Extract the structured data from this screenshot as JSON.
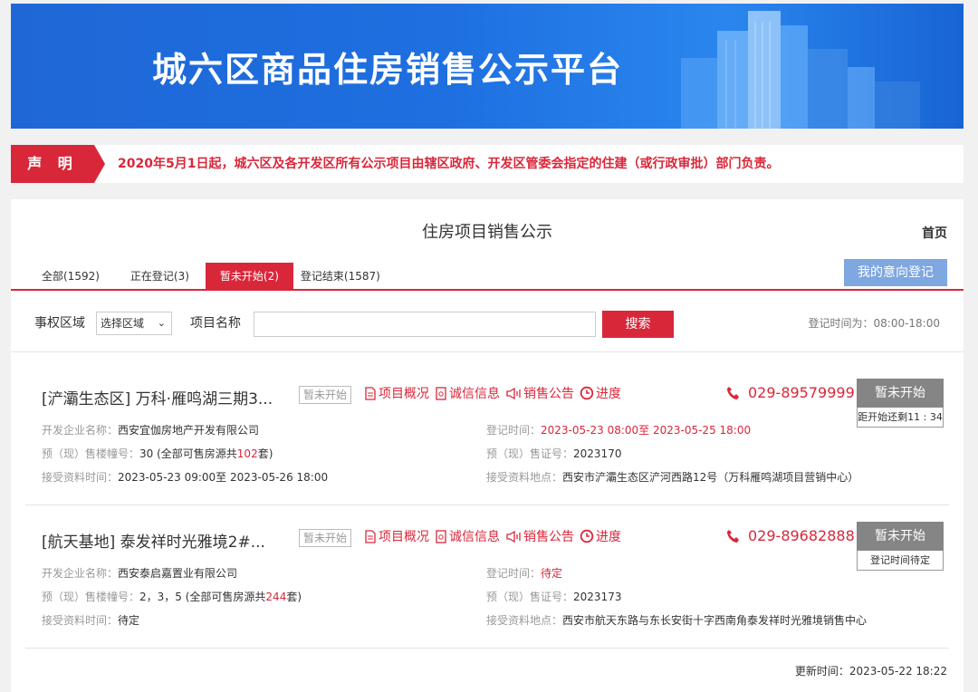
{
  "banner": {
    "title": "城六区商品住房销售公示平台"
  },
  "notice": {
    "tag": "声 明",
    "text": "2020年5月1日起，城六区及各开发区所有公示项目由辖区政府、开发区管委会指定的住建（或行政审批）部门负责。"
  },
  "header": {
    "title": "住房项目销售公示",
    "home": "首页"
  },
  "tabs": [
    {
      "label": "全部(1592)"
    },
    {
      "label": "正在登记(3)"
    },
    {
      "label": "暂未开始(2)",
      "active": true
    },
    {
      "label": "登记结束(1587)"
    }
  ],
  "intent_button": "我的意向登记",
  "search": {
    "area_label": "事权区域",
    "area_select": "选择区域",
    "name_label": "项目名称",
    "name_value": "",
    "button": "搜索",
    "reg_time": "登记时间为：08:00-18:00"
  },
  "link_labels": {
    "overview": "项目概况",
    "integrity": "诚信信息",
    "announce": "销售公告",
    "progress": "进度"
  },
  "projects": [
    {
      "title": "[浐灞生态区] 万科·雁鸣湖三期3...",
      "tag": "暂未开始",
      "phone": "029-89579999",
      "status": "暂未开始",
      "status_sub": "距开始还剩11 : 34",
      "dev_label": "开发企业名称：",
      "dev": "西安宜伽房地产开发有限公司",
      "reg_label": "登记时间：",
      "reg": "2023-05-23 08:00至 2023-05-25 18:00",
      "bld_label": "预（现）售楼幢号：",
      "bld_pre": "30 (全部可售房源共",
      "bld_count": "102",
      "bld_post": "套)",
      "cert_label": "预（现）售证号：",
      "cert": "2023170",
      "accept_label": "接受资料时间：",
      "accept": "2023-05-23 09:00至 2023-05-26 18:00",
      "place_label": "接受资料地点：",
      "place": "西安市浐灞生态区浐河西路12号（万科雁鸣湖项目营销中心）"
    },
    {
      "title": "[航天基地] 泰发祥时光雅境2#...",
      "tag": "暂未开始",
      "phone": "029-89682888",
      "status": "暂未开始",
      "status_sub": "登记时间待定",
      "dev_label": "开发企业名称：",
      "dev": "西安泰启嘉置业有限公司",
      "reg_label": "登记时间：",
      "reg": "待定",
      "bld_label": "预（现）售楼幢号：",
      "bld_pre": "2，3，5 (全部可售房源共",
      "bld_count": "244",
      "bld_post": "套)",
      "cert_label": "预（现）售证号：",
      "cert": "2023173",
      "accept_label": "接受资料时间：",
      "accept": "待定",
      "place_label": "接受资料地点：",
      "place": "西安市航天东路与东长安街十字西南角泰发祥时光雅境销售中心"
    }
  ],
  "update": "更新时间：2023-05-22 18:22"
}
